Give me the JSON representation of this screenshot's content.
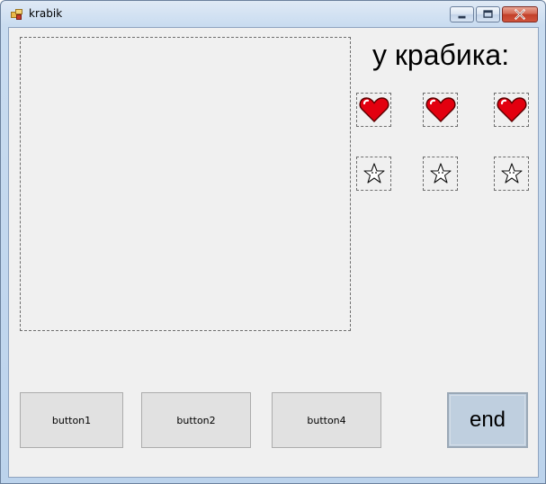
{
  "window": {
    "title": "krabik",
    "controls": {
      "minimize_icon": "minimize-icon",
      "maximize_icon": "maximize-icon",
      "close_icon": "close-icon"
    }
  },
  "main": {
    "lives_label": "у крабика:",
    "hearts": [
      "heart-icon",
      "heart-icon",
      "heart-icon"
    ],
    "stars": [
      "star-icon",
      "star-icon",
      "star-icon"
    ]
  },
  "buttons": {
    "button1": "button1",
    "button2": "button2",
    "button4": "button4",
    "end": "end"
  },
  "colors": {
    "heart": "#e3000f",
    "end_button": "#bfcfdf",
    "form_background": "#f0f0f0"
  }
}
